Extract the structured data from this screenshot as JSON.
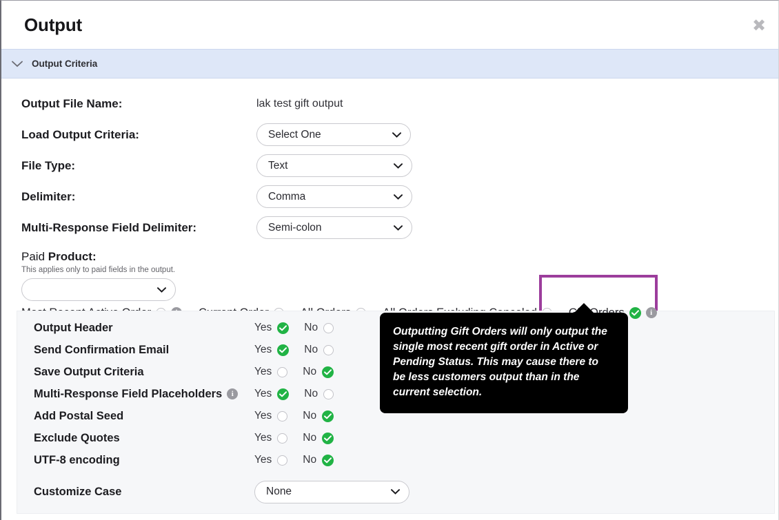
{
  "dialog": {
    "title": "Output",
    "close_label": "✖"
  },
  "criteria_section": {
    "label": "Output Criteria",
    "toggle_icon": "chevron-down-icon"
  },
  "fields": {
    "output_file_name": {
      "label": "Output File Name:",
      "value": "lak test gift output"
    },
    "load_output_criteria": {
      "label": "Load Output Criteria:",
      "value": "Select One"
    },
    "file_type": {
      "label": "File Type:",
      "value": "Text"
    },
    "delimiter": {
      "label": "Delimiter:",
      "value": "Comma"
    },
    "multi_response_field_delimiter": {
      "label": "Multi-Response Field Delimiter:",
      "value": "Semi-colon"
    }
  },
  "paid_product": {
    "label_light": "Paid ",
    "label_bold": "Product:",
    "note": "This applies only to paid fields in the output.",
    "value": ""
  },
  "order_options": [
    {
      "label": "Most Recent Active Order",
      "selected": false,
      "has_info": true
    },
    {
      "label": "Current Order",
      "selected": false,
      "has_info": false
    },
    {
      "label": "All Orders",
      "selected": false,
      "has_info": false
    },
    {
      "label": "All Orders Excluding Canceled",
      "selected": false,
      "has_info": false
    },
    {
      "label": "Gift Orders",
      "selected": true,
      "has_info": true
    }
  ],
  "highlight": {
    "color": "#9c3d9c",
    "target": "Gift Orders"
  },
  "tooltip": {
    "text": "Outputting Gift Orders will only output the single most recent gift order in Active or Pending Status. This may cause there to be less customers output than in the current selection."
  },
  "yes_no_labels": {
    "yes": "Yes",
    "no": "No"
  },
  "options": [
    {
      "label": "Output Header",
      "yes": true,
      "no": false,
      "has_info": false
    },
    {
      "label": "Send Confirmation Email",
      "yes": true,
      "no": false,
      "has_info": false
    },
    {
      "label": "Save Output Criteria",
      "yes": false,
      "no": true,
      "has_info": false
    },
    {
      "label": "Multi-Response Field Placeholders",
      "yes": true,
      "no": false,
      "has_info": true
    },
    {
      "label": "Add Postal Seed",
      "yes": false,
      "no": true,
      "has_info": false
    },
    {
      "label": "Exclude Quotes",
      "yes": false,
      "no": true,
      "has_info": false
    },
    {
      "label": "UTF-8 encoding",
      "yes": false,
      "no": true,
      "has_info": false
    }
  ],
  "customize_case": {
    "label": "Customize Case",
    "value": "None"
  },
  "colors": {
    "accent_blue": "#dee7f8",
    "selected_green": "#21b345",
    "highlight_purple": "#9c3d9c",
    "info_gray": "#9a9aa0",
    "panel_gray": "#f6f7f9"
  }
}
